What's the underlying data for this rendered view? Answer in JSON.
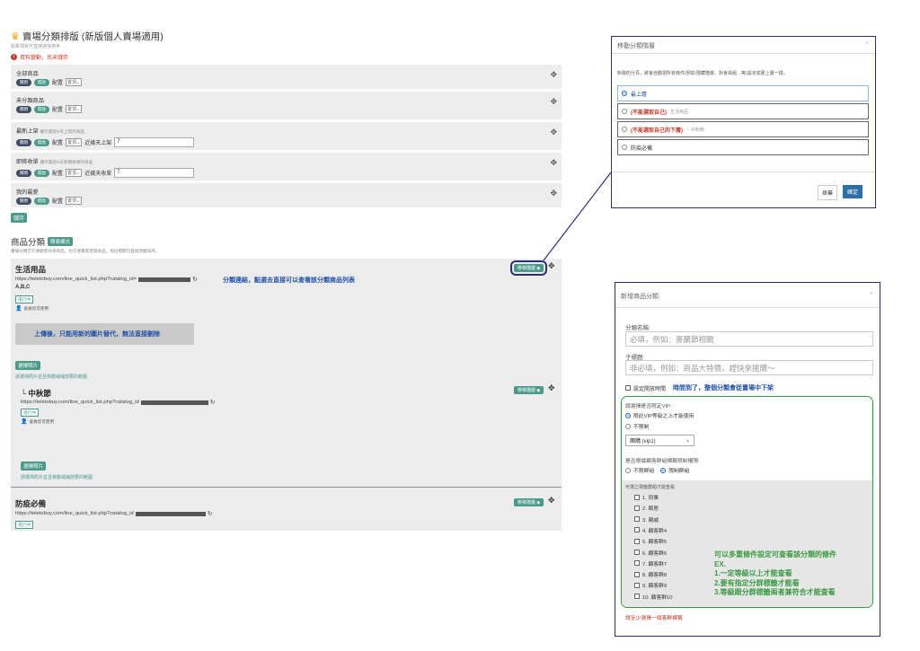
{
  "sort_panel": {
    "title": "賣場分類排版 (新版個人賣場適用)",
    "subtitle": "點擊項目可直接拖曳排序",
    "warning": "資料變動，尚未儲存",
    "warning_icon": "exclamation-icon",
    "btn_hide": "關閉",
    "btn_show": "開啟",
    "config_label": "配置",
    "config_value": "置頂",
    "boxes": [
      {
        "title": "全部商品",
        "hint": "",
        "extra_label": "",
        "extra_value": ""
      },
      {
        "title": "未分類商品",
        "hint": "",
        "extra_label": "",
        "extra_value": ""
      },
      {
        "title": "最新上架",
        "hint": "顯示最近N天上架的商品",
        "extra_label": "近幾天上架",
        "extra_value": "7"
      },
      {
        "title": "即將收單",
        "hint": "顯示最近N天即將收單的商品",
        "extra_label": "近幾天收單",
        "extra_value": "7"
      },
      {
        "title": "我的最愛",
        "hint": "",
        "extra_label": "",
        "extra_value": ""
      }
    ],
    "save_label": "儲存"
  },
  "categories": {
    "title": "商品分類",
    "mode_btn": "簡易模式",
    "subtitle": "賣場分類可方便顧客找尋商品，也方便賣家管理商品，拖拉標題可直接改變排序。",
    "move_btn": "移移階層",
    "move_caret": "◆",
    "status": "進行中",
    "perm": "會員皆可使用",
    "perm_icon": "user-icon",
    "refresh_icon": "refresh-icon",
    "drag_icon": "drag-move-icon",
    "items": [
      {
        "name": "生活用品",
        "url": "https://teletobuy.com/line_quick_list.php?catalog_id=",
        "url_note": "分類連結，點選去直接可以查看該分類商品列表",
        "code": "A,B,C",
        "banner": "上傳後，只能用新的圖片替代，無法直接刪除",
        "pick_btn": "選擇照片",
        "pick_hint": "請選擇照片並且移動或縮放要的範圍"
      },
      {
        "name": "└ 中秋節",
        "url": "https://teletobuy.com/line_quick_list.php?catalog_id",
        "pick_btn": "選擇照片",
        "pick_hint": "請選擇照片並且移動或縮放要的範圍"
      },
      {
        "name": "防疫必備",
        "url": "https://teletobuy.com/line_quick_list.php?catalog_id"
      }
    ]
  },
  "move_modal": {
    "title": "移動分類階層",
    "close": "×",
    "desc": "新層的分頁，將會自動把所有條件(例如:隱藏階層、對會員組…等)設定成那上層一樣。",
    "options": [
      {
        "label": "最上層",
        "warn": "",
        "path": "",
        "selected": true
      },
      {
        "label": "",
        "warn": "(不能選取自己)",
        "path": "生活用品",
        "selected": false
      },
      {
        "label": "",
        "warn": "(不能選取自己的下層)",
        "path": "└ 中秋節",
        "selected": false
      },
      {
        "label": "防疫必備",
        "warn": "",
        "path": "",
        "selected": false
      }
    ],
    "cancel": "捨棄",
    "ok": "確定"
  },
  "new_modal": {
    "title": "新增商品分類",
    "close": "×",
    "name_label": "分類名稱:",
    "name_placeholder": "必填，例如：麥蘭節相關",
    "subtitle_label": "子標題:",
    "subtitle_placeholder": "非必填，例如：商品大特價，趕快來搶購～",
    "schedule_label": "設定開放時間",
    "schedule_note": "時間到了，整個分類會從賣場中下架",
    "vip_label": "請選擇是否限定VIP:",
    "vip_opt1": "限此VIP等級之上才能使用",
    "vip_opt2": "不限制",
    "vip_select": "團購 (vip1)",
    "group_label": "是否根據顧客群組標籤限制權限:",
    "group_opt1": "不限群組",
    "group_opt2": "限制群組",
    "group_list_label": "可選之標籤群組才能查看",
    "groups": [
      "1. 同事",
      "2. 鄰居",
      "3. 親戚",
      "4. 顧客群4",
      "5. 顧客群5",
      "6. 顧客群6",
      "7. 顧客群7",
      "8. 顧客群8",
      "9. 顧客群9",
      "10. 顧客群10"
    ],
    "note_lines": [
      "可以多重條件設定可查看該分類的條件",
      "EX.",
      "1.一定等級以上才能查看",
      "2.要有指定分群標籤才能看",
      "3.等級跟分群標籤兩者兼符合才能查看"
    ],
    "footer_warn": "請至少選擇一個客群標籤"
  },
  "colors": {
    "teal": "#4a9a8a",
    "navy": "#2c2e74",
    "green": "#3a9a43",
    "red": "#c0392b",
    "blue": "#1f4fa8"
  }
}
